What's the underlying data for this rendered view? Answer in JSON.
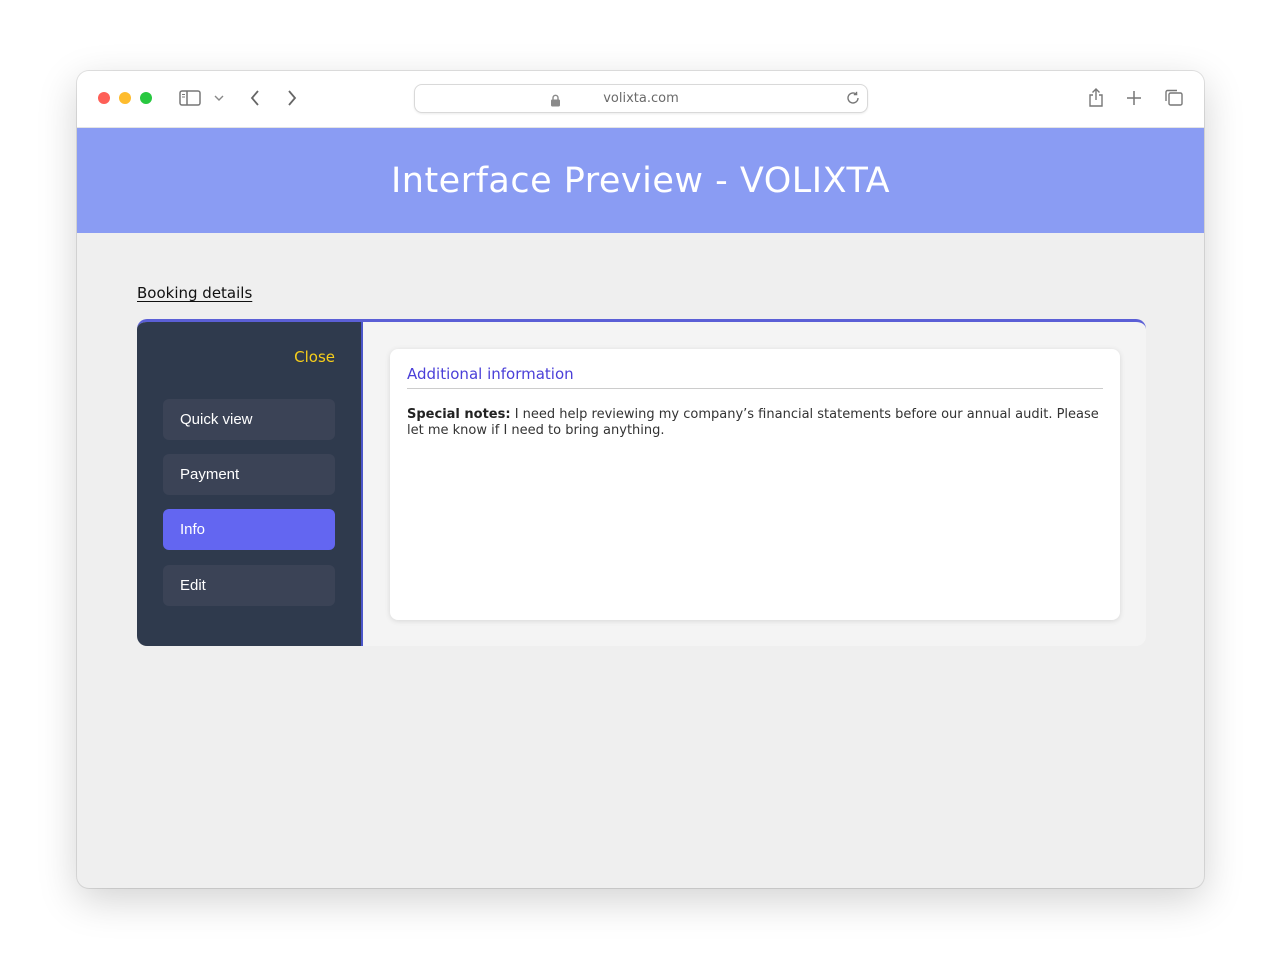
{
  "browser": {
    "url": "volixta.com",
    "icons": [
      "sidebar-icon",
      "chevron-down-icon",
      "back-icon",
      "forward-icon",
      "lock-icon",
      "reload-icon",
      "share-icon",
      "new-tab-icon",
      "tabs-overview-icon"
    ]
  },
  "header": {
    "title": "Interface Preview - VOLIXTA"
  },
  "breadcrumb": {
    "link_label": "Booking details"
  },
  "sidebar": {
    "close_label": "Close",
    "items": [
      {
        "label": "Quick view",
        "active": false
      },
      {
        "label": "Payment",
        "active": false
      },
      {
        "label": "Info",
        "active": true
      },
      {
        "label": "Edit",
        "active": false
      }
    ]
  },
  "content": {
    "section_title": "Additional information",
    "notes_label": "Special notes:",
    "notes_text": " I need help reviewing my company’s financial statements before our annual audit. Please let me know if I need to bring anything."
  },
  "colors": {
    "banner": "#8a9cf3",
    "sidebar_bg": "#2f3a4d",
    "active_item": "#6366f1",
    "close_text": "#f7ce1a",
    "section_title": "#4a3fd8"
  }
}
